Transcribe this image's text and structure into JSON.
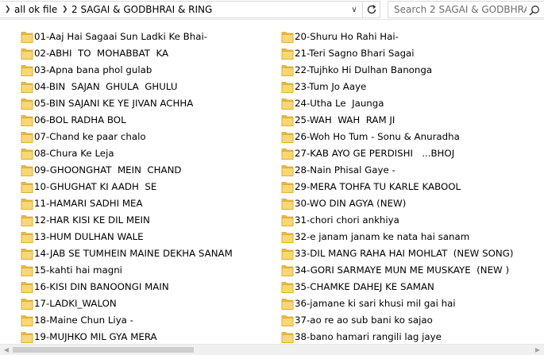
{
  "address_bar": {
    "breadcrumbs": [
      "all ok file",
      "2 SAGAI & GODBHRAI & RING"
    ],
    "dropdown_icon": "chevron-down-icon",
    "refresh_icon": "refresh-icon"
  },
  "search": {
    "placeholder": "Search 2 SAGAI & GODBHRAI ...",
    "icon": "search-icon"
  },
  "colors": {
    "folder_front": "#f8d775",
    "folder_back": "#e8b93d",
    "folder_edge": "#d9a630"
  },
  "folders": {
    "left": [
      "01-Aaj Hai Sagaai Sun Ladki Ke Bhai-",
      "02-ABHI  TO  MOHABBAT  KA",
      "03-Apna bana phol gulab",
      "04-BIN  SAJAN  GHULA  GHULU",
      "05-BIN SAJANI KE YE JIVAN ACHHA",
      "06-BOL RADHA BOL",
      "07-Chand ke paar chalo",
      "08-Chura Ke Leja",
      "09-GHOONGHAT  MEIN  CHAND",
      "10-GHUGHAT KI AADH  SE",
      "11-HAMARI SADHI MEA",
      "12-HAR KISI KE DIL MEIN",
      "13-HUM DULHAN WALE",
      "14-JAB SE TUMHEIN MAINE DEKHA SANAM",
      "15-kahti hai magni",
      "16-KISI DIN BANOONGI MAIN",
      "17-LADKI_WALON",
      "18-Maine Chun Liya -",
      "19-MUJHKO MIL GYA MERA"
    ],
    "right": [
      "20-Shuru Ho Rahi Hai-",
      "21-Teri Sagno Bhari Sagai",
      "22-Tujhko Hi Dulhan Banonga",
      "23-Tum Jo Aaye",
      "24-Utha Le  Jaunga",
      "25-WAH  WAH  RAM JI",
      "26-Woh Ho Tum - Sonu & Anuradha",
      "27-KAB AYO GE PERDISHI   ...BHOJ",
      "28-Nain Phisal Gaye -",
      "29-MERA TOHFA TU KARLE KABOOL",
      "30-WO DIN AGYA (NEW)",
      "31-chori chori ankhiya",
      "32-e janam janam ke nata hai sanam",
      "33-DIL MANG RAHA HAI MOHLAT  (NEW SONG)",
      "34-GORI SARMAYE MUN ME MUSKAYE  (NEW )",
      "35-CHAMKE DAHEJ KE SAMAN",
      "36-jamane ki sari khusi mil gai hai",
      "37-ao re ao sub bani ko sajao",
      "38-bano hamari rangili lag jaye"
    ]
  }
}
